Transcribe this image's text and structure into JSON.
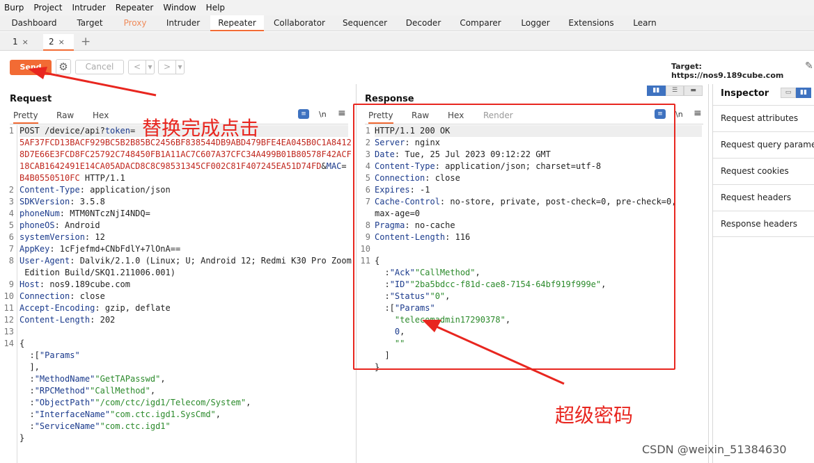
{
  "menubar": [
    "Burp",
    "Project",
    "Intruder",
    "Repeater",
    "Window",
    "Help"
  ],
  "main_tabs": [
    "Dashboard",
    "Target",
    "Proxy",
    "Intruder",
    "Repeater",
    "Collaborator",
    "Sequencer",
    "Decoder",
    "Comparer",
    "Logger",
    "Extensions",
    "Learn"
  ],
  "repeater_tabs": [
    {
      "label": "1",
      "close": "×"
    },
    {
      "label": "2",
      "close": "×"
    }
  ],
  "add_tab": "+",
  "toolbar": {
    "send": "Send",
    "cancel": "Cancel",
    "prev": "<",
    "next": ">",
    "dropdown": "▾",
    "target": "Target: https://nos9.189cube.com"
  },
  "request": {
    "title": "Request",
    "tabs": [
      "Pretty",
      "Raw",
      "Hex"
    ],
    "ln_label": "\\n",
    "line_numbers": [
      "1",
      "",
      "",
      "",
      "",
      "2",
      "3",
      "4",
      "5",
      "6",
      "7",
      "8",
      "",
      "9",
      "10",
      "11",
      "12",
      "13",
      "14"
    ],
    "lines": [
      {
        "a": "POST /device/api?",
        "k": "token",
        "b": "="
      },
      {
        "r": "5AF37FCD13BACF929BC5B2B85BC2456BF838544DB9ABD479BFE4EA045B0C1A8412"
      },
      {
        "r": "8D7E66E3FCD8FC25792C748450FB1A11AC7C607A37CFC34A499B01B80578F42ACF"
      },
      {
        "r": "18CAB1642491E14CA05ADACD8C8C98531345CF002C81F407245EA51D74FD",
        "b": "&",
        "k": "MAC",
        "b2": "="
      },
      {
        "r": "B4B0550510FC",
        "a": " HTTP/1.1"
      },
      {
        "k": "Content-Type",
        "a": ": application/json"
      },
      {
        "k": "SDKVersion",
        "a": ": 3.5.8"
      },
      {
        "k": "phoneNum",
        "a": ": MTM0NTczNjI4NDQ="
      },
      {
        "k": "phoneOS",
        "a": ": Android"
      },
      {
        "k": "systemVersion",
        "a": ": 12"
      },
      {
        "k": "AppKey",
        "a": ": 1cFjefmd+CNbFdlY+7lOnA=="
      },
      {
        "k": "User-Agent",
        "a": ": Dalvik/2.1.0 (Linux; U; Android 12; Redmi K30 Pro Zoom"
      },
      {
        "a": " Edition Build/SKQ1.211006.001)"
      },
      {
        "k": "Host",
        "a": ": nos9.189cube.com"
      },
      {
        "k": "Connection",
        "a": ": close"
      },
      {
        "k": "Accept-Encoding",
        "a": ": gzip, deflate"
      },
      {
        "k": "Content-Length",
        "a": ": 202"
      },
      {
        "a": ""
      },
      {
        "a": "{"
      },
      {
        "a": "  ",
        "jk": "\"Params\"",
        "b": ":["
      },
      {
        "a": "  ],"
      },
      {
        "a": "  ",
        "jk": "\"MethodName\"",
        "b": ":",
        "js": "\"GetTAPasswd\"",
        "c": ","
      },
      {
        "a": "  ",
        "jk": "\"RPCMethod\"",
        "b": ":",
        "js": "\"CallMethod\"",
        "c": ","
      },
      {
        "a": "  ",
        "jk": "\"ObjectPath\"",
        "b": ":",
        "js": "\"/com/ctc/igd1/Telecom/System\"",
        "c": ","
      },
      {
        "a": "  ",
        "jk": "\"InterfaceName\"",
        "b": ":",
        "js": "\"com.ctc.igd1.SysCmd\"",
        "c": ","
      },
      {
        "a": "  ",
        "jk": "\"ServiceName\"",
        "b": ":",
        "js": "\"com.ctc.igd1\""
      },
      {
        "a": "}"
      }
    ]
  },
  "response": {
    "title": "Response",
    "tabs": [
      "Pretty",
      "Raw",
      "Hex",
      "Render"
    ],
    "ln_label": "\\n",
    "line_numbers": [
      "1",
      "2",
      "3",
      "4",
      "5",
      "6",
      "7",
      "",
      "8",
      "9",
      "10",
      "11"
    ],
    "lines": [
      {
        "a": "HTTP/1.1 200 OK"
      },
      {
        "k": "Server",
        "a": ": nginx"
      },
      {
        "k": "Date",
        "a": ": Tue, 25 Jul 2023 09:12:22 GMT"
      },
      {
        "k": "Content-Type",
        "a": ": application/json; charset=utf-8"
      },
      {
        "k": "Connection",
        "a": ": close"
      },
      {
        "k": "Expires",
        "a": ": -1"
      },
      {
        "k": "Cache-Control",
        "a": ": no-store, private, post-check=0, pre-check=0,"
      },
      {
        "a": "max-age=0"
      },
      {
        "k": "Pragma",
        "a": ": no-cache"
      },
      {
        "k": "Content-Length",
        "a": ": 116"
      },
      {
        "a": ""
      },
      {
        "a": "{"
      },
      {
        "a": "  ",
        "jk": "\"Ack\"",
        "b": ":",
        "js": "\"CallMethod\"",
        "c": ","
      },
      {
        "a": "  ",
        "jk": "\"ID\"",
        "b": ":",
        "js": "\"2ba5bdcc-f81d-cae8-7154-64bf919f999e\"",
        "c": ","
      },
      {
        "a": "  ",
        "jk": "\"Status\"",
        "b": ":",
        "js": "\"0\"",
        "c": ","
      },
      {
        "a": "  ",
        "jk": "\"Params\"",
        "b": ":["
      },
      {
        "a": "    ",
        "js": "\"telecomadmin17290378\"",
        "c": ","
      },
      {
        "a": "    ",
        "jn": "0",
        "c": ","
      },
      {
        "a": "    ",
        "js": "\"\""
      },
      {
        "a": "  ]"
      },
      {
        "a": "}"
      }
    ]
  },
  "inspector": {
    "title": "Inspector",
    "items": [
      "Request attributes",
      "Request query parameters",
      "Request cookies",
      "Request headers",
      "Response headers"
    ]
  },
  "annotations": {
    "click_after_replace": "替换完成点击",
    "super_password": "超级密码"
  },
  "watermark": "CSDN @weixin_51384630",
  "colors": {
    "accent": "#f26b34",
    "annotation": "#e8261f",
    "header_key": "#1a3a8c",
    "url_param": "#c0271e",
    "json_string": "#2b8a2b"
  }
}
